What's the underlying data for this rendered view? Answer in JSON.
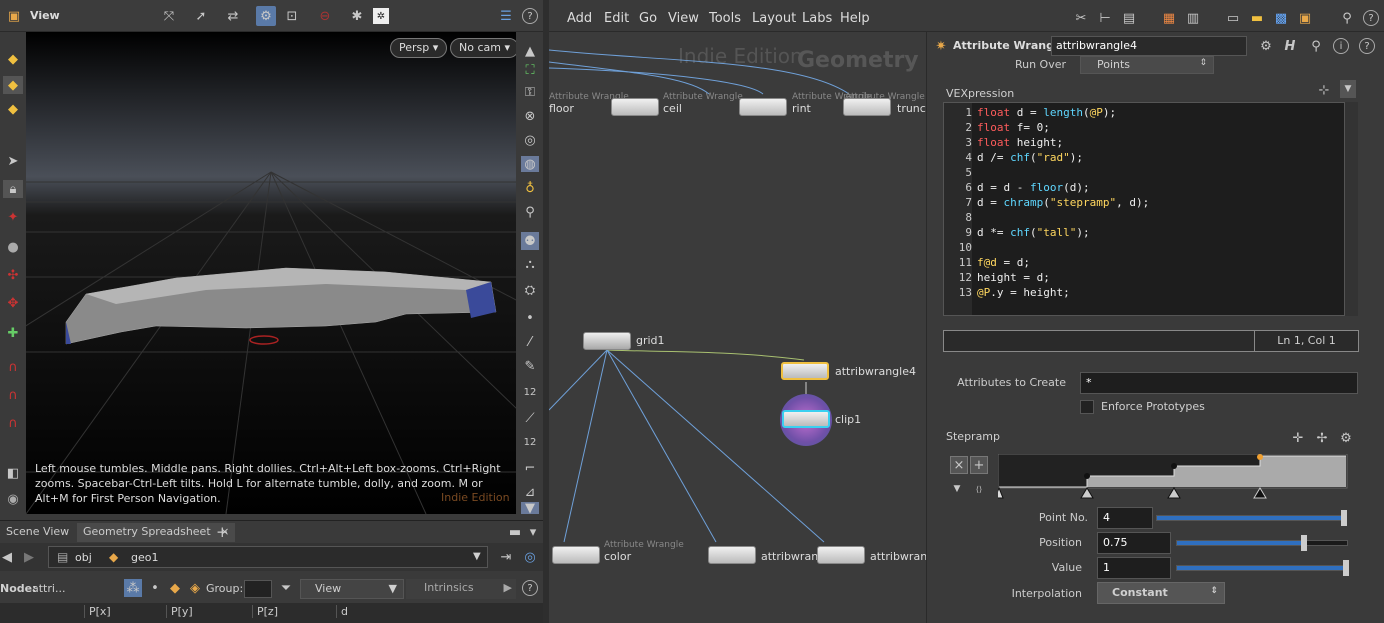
{
  "viewer": {
    "title": "View",
    "persp_label": "Persp",
    "cam_label": "No cam",
    "hint": "Left mouse tumbles. Middle pans. Right dollies. Ctrl+Alt+Left box-zooms. Ctrl+Right zooms. Spacebar-Ctrl-Left tilts. Hold L for alternate tumble, dolly, and zoom.    M or Alt+M for First Person Navigation.",
    "watermark": "Indie Edition"
  },
  "bottom_tabs": {
    "tab1": "Scene View",
    "tab2": "Geometry Spreadsheet",
    "add": "+"
  },
  "path": {
    "obj": "obj",
    "geo": "geo1"
  },
  "spreadsheet": {
    "node_label": "Node:",
    "node_value": "attri...",
    "group_label": "Group:",
    "view_label": "View",
    "intrinsics_label": "Intrinsics",
    "columns": [
      "P[x]",
      "P[y]",
      "P[z]",
      "d"
    ]
  },
  "menu": {
    "items": [
      "Add",
      "Edit",
      "Go",
      "View",
      "Tools",
      "Layout",
      "Labs",
      "Help"
    ]
  },
  "network": {
    "watermark_edition": "Indie Edition",
    "watermark_context": "Geometry",
    "nodes_top": [
      {
        "type": "Attribute Wrangle",
        "name": "floor"
      },
      {
        "type": "Attribute Wrangle",
        "name": "ceil"
      },
      {
        "type": "Attribute Wrangle",
        "name": "rint"
      },
      {
        "type": "Attribute Wrangle",
        "name": "trunc"
      }
    ],
    "grid": "grid1",
    "wrangle": "attribwrangle4",
    "clip": "clip1",
    "nodes_bottom": [
      {
        "type": "Attribute Wrangle",
        "name": "color"
      },
      {
        "type": "",
        "name": "attribwrang"
      },
      {
        "type": "",
        "name": "attribwrang"
      }
    ]
  },
  "params": {
    "node_type": "Attribute Wrangle",
    "node_name": "attribwrangle4",
    "run_over_label": "Run Over",
    "run_over_value": "Points",
    "vex_label": "VEXpression",
    "cursor_pos": "Ln 1, Col 1",
    "attr_create_label": "Attributes to Create",
    "attr_create_value": "*",
    "enforce_label": "Enforce Prototypes",
    "stepramp_label": "Stepramp",
    "point_no_label": "Point No.",
    "point_no_value": "4",
    "position_label": "Position",
    "position_value": "0.75",
    "value_label": "Value",
    "value_value": "1",
    "interp_label": "Interpolation",
    "interp_value": "Constant"
  },
  "code_lines": [
    "float d = length(@P);",
    "float f= 0;",
    "float height;",
    "d /= chf(\"rad\");",
    "",
    "d = d - floor(d);",
    "d = chramp(\"stepramp\", d);",
    "",
    "d *= chf(\"tall\");",
    "",
    "f@d = d;",
    "height = d;",
    "@P.y = height;"
  ],
  "line_numbers": [
    "1",
    "2",
    "3",
    "4",
    "5",
    "6",
    "7",
    "8",
    "9",
    "10",
    "11",
    "12",
    "13"
  ],
  "colors": {
    "accent": "#2f6fbf",
    "wire": "#6fa0d8",
    "selected": "#f0c040",
    "watermark": "#7a4a22"
  }
}
